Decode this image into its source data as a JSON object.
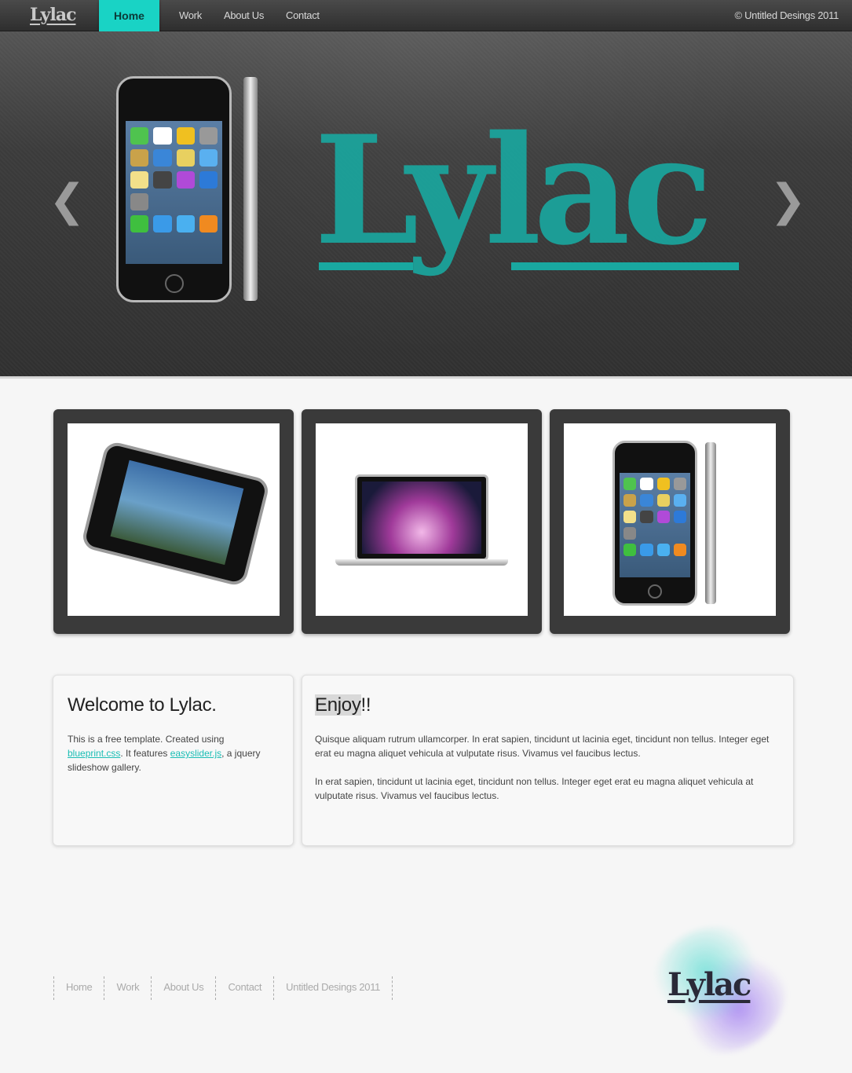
{
  "header": {
    "logo": "Lylac",
    "nav": [
      "Home",
      "Work",
      "About Us",
      "Contact"
    ],
    "active": "Home",
    "copyright": "© Untitled Desings 2011"
  },
  "hero": {
    "logo_text": "Lylac",
    "prev_arrow": "❮",
    "next_arrow": "❯",
    "accent": "#19a8a0"
  },
  "welcome": {
    "title": "Welcome to Lylac.",
    "text_before": "This is a free template. Created using ",
    "link1": "blueprint.css",
    "text_mid": ". It features ",
    "link2": "easyslider.js",
    "text_after": ", a jquery slideshow gallery."
  },
  "enjoy": {
    "title_hl": "Enjoy",
    "title_rest": "!!",
    "para1": "Quisque aliquam rutrum ullamcorper. In erat sapien, tincidunt ut lacinia eget, tincidunt non tellus. Integer eget erat eu magna aliquet vehicula at vulputate risus. Vivamus vel faucibus lectus.",
    "para2": "In erat sapien, tincidunt ut lacinia eget, tincidunt non tellus. Integer eget erat eu magna aliquet vehicula at vulputate risus. Vivamus vel faucibus lectus."
  },
  "footer": {
    "nav": [
      "Home",
      "Work",
      "About Us",
      "Contact",
      "Untitled Desings 2011"
    ],
    "logo": "Lylac"
  },
  "colors": {
    "accent": "#19d3c5",
    "dark": "#3a3a3a",
    "background": "#f6f6f6"
  }
}
